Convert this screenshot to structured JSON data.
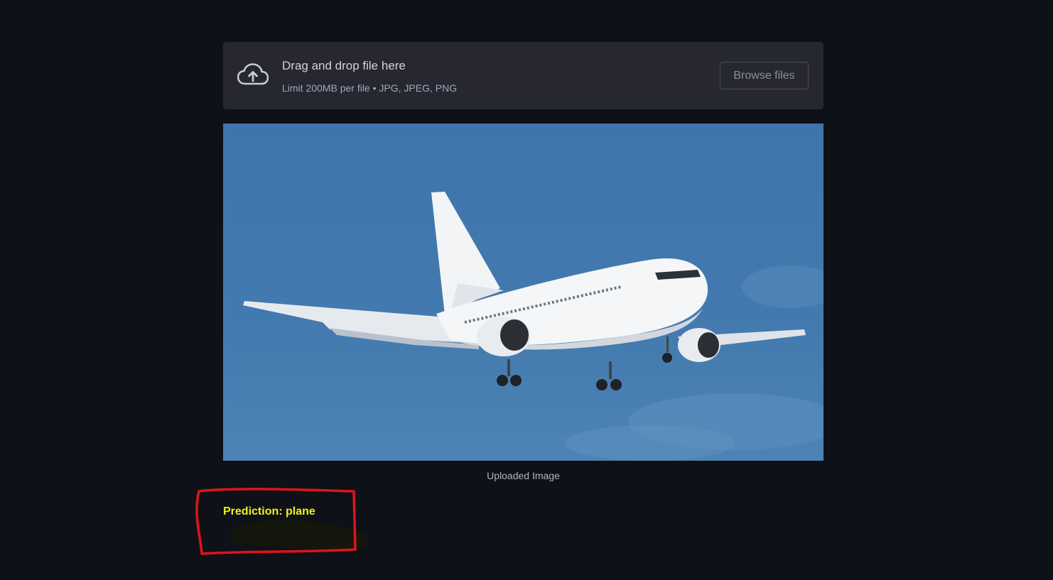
{
  "uploader": {
    "icon": "cloud-upload-icon",
    "title": "Drag and drop file here",
    "limit": "Limit 200MB per file • JPG, JPEG, PNG",
    "browse_label": "Browse files"
  },
  "image": {
    "subject": "plane",
    "caption": "Uploaded Image"
  },
  "result": {
    "prediction": "Prediction: plane"
  },
  "colors": {
    "background": "#0e1117",
    "uploader_bg": "#262730",
    "prediction_text": "#f0f020",
    "annotation_stroke": "#e0141a"
  }
}
